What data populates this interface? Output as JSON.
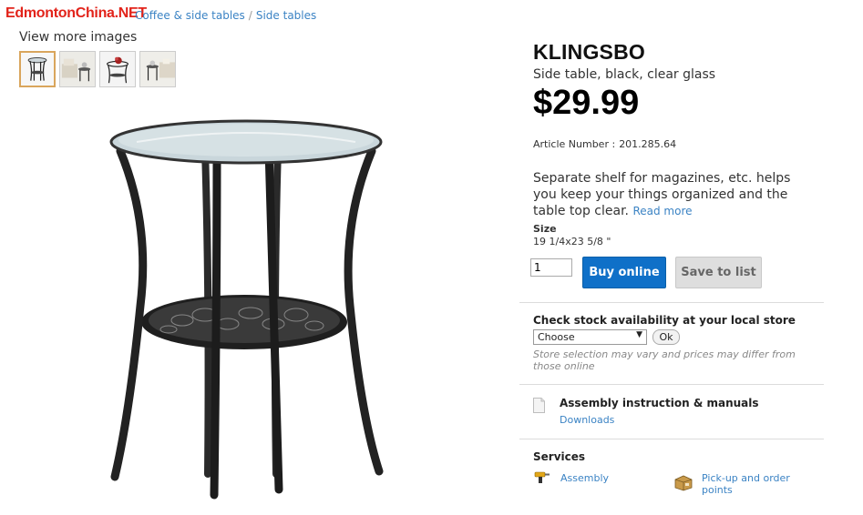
{
  "watermark": "EdmontonChina.NET",
  "breadcrumb": {
    "items": [
      "Coffee & side tables",
      "Side tables"
    ],
    "separator": "/"
  },
  "gallery": {
    "title": "View more images",
    "thumbnails": [
      "table-black-front",
      "table-in-room",
      "table-with-plant",
      "table-beside-sofa"
    ]
  },
  "product": {
    "name": "KLINGSBO",
    "description": "Side table, black, clear glass",
    "price": "$29.99",
    "article_label": "Article Number :",
    "article_number": "201.285.64",
    "summary": "Separate shelf for magazines, etc. helps you keep your things organized and the table top clear.",
    "read_more": "Read more",
    "size_label": "Size",
    "size_value": "19 1/4x23 5/8 \""
  },
  "purchase": {
    "quantity": "1",
    "buy_label": "Buy online",
    "save_label": "Save to list"
  },
  "stock": {
    "title": "Check stock availability at your local store",
    "select_value": "Choose",
    "ok_label": "Ok",
    "note": "Store selection may vary and prices may differ from those online"
  },
  "assembly": {
    "title": "Assembly instruction & manuals",
    "downloads": "Downloads"
  },
  "services": {
    "title": "Services",
    "assembly": "Assembly",
    "pickup": "Pick-up and order points"
  },
  "colors": {
    "link": "#3b83c4",
    "buy_button": "#0f70c8",
    "watermark": "#e2231a"
  }
}
